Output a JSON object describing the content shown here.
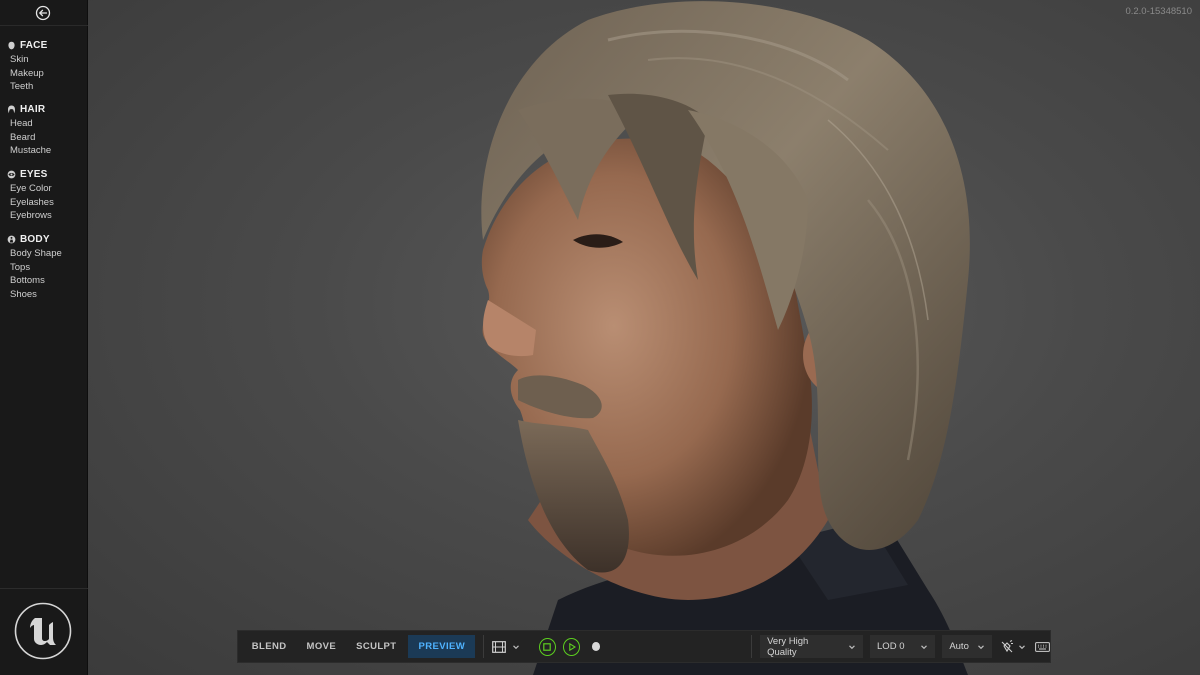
{
  "app": {
    "version": "0.2.0-15348510"
  },
  "sidebar": {
    "sections": [
      {
        "title": "FACE",
        "icon": "face-icon",
        "items": [
          "Skin",
          "Makeup",
          "Teeth"
        ]
      },
      {
        "title": "HAIR",
        "icon": "hair-icon",
        "items": [
          "Head",
          "Beard",
          "Mustache"
        ]
      },
      {
        "title": "EYES",
        "icon": "eye-icon",
        "items": [
          "Eye Color",
          "Eyelashes",
          "Eyebrows"
        ]
      },
      {
        "title": "BODY",
        "icon": "body-icon",
        "items": [
          "Body Shape",
          "Tops",
          "Bottoms",
          "Shoes"
        ]
      }
    ],
    "back_icon": "back-arrow-icon",
    "logo_icon": "unreal-logo-icon"
  },
  "toolbar": {
    "modes": [
      {
        "label": "BLEND",
        "active": false
      },
      {
        "label": "MOVE",
        "active": false
      },
      {
        "label": "SCULPT",
        "active": false
      },
      {
        "label": "PREVIEW",
        "active": true
      }
    ],
    "camera_icon": "film-camera-icon",
    "stop_icon": "stop-icon",
    "play_icon": "play-icon",
    "record_icon": "record-icon",
    "quality": "Very High Quality",
    "lod": "LOD 0",
    "lighting": "Auto",
    "lighting_icon": "light-off-icon",
    "keyboard_icon": "keyboard-icon",
    "accent_color": "#4fb3ff",
    "playback_color": "#5ccf1f"
  }
}
